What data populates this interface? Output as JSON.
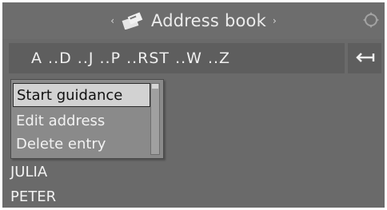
{
  "header": {
    "title": "Address book",
    "left_arrow": "‹",
    "right_arrow": "›",
    "title_icon": "address-book-icon",
    "corner_icon": "controller-knob-icon"
  },
  "letter_bar": {
    "letters": "A ..D ..J ..P ..RST ..W ..Z",
    "back_icon": "back-arrow-icon"
  },
  "context_menu": {
    "items": [
      {
        "label": "Start guidance",
        "selected": true
      },
      {
        "label": "Edit address",
        "selected": false
      },
      {
        "label": "Delete entry",
        "selected": false
      }
    ]
  },
  "entries": [
    {
      "name": "JULIA"
    },
    {
      "name": "PETER"
    }
  ],
  "colors": {
    "background": "#6a6a6a",
    "selection": "#d2d2d2",
    "text": "#f2f2f2"
  }
}
